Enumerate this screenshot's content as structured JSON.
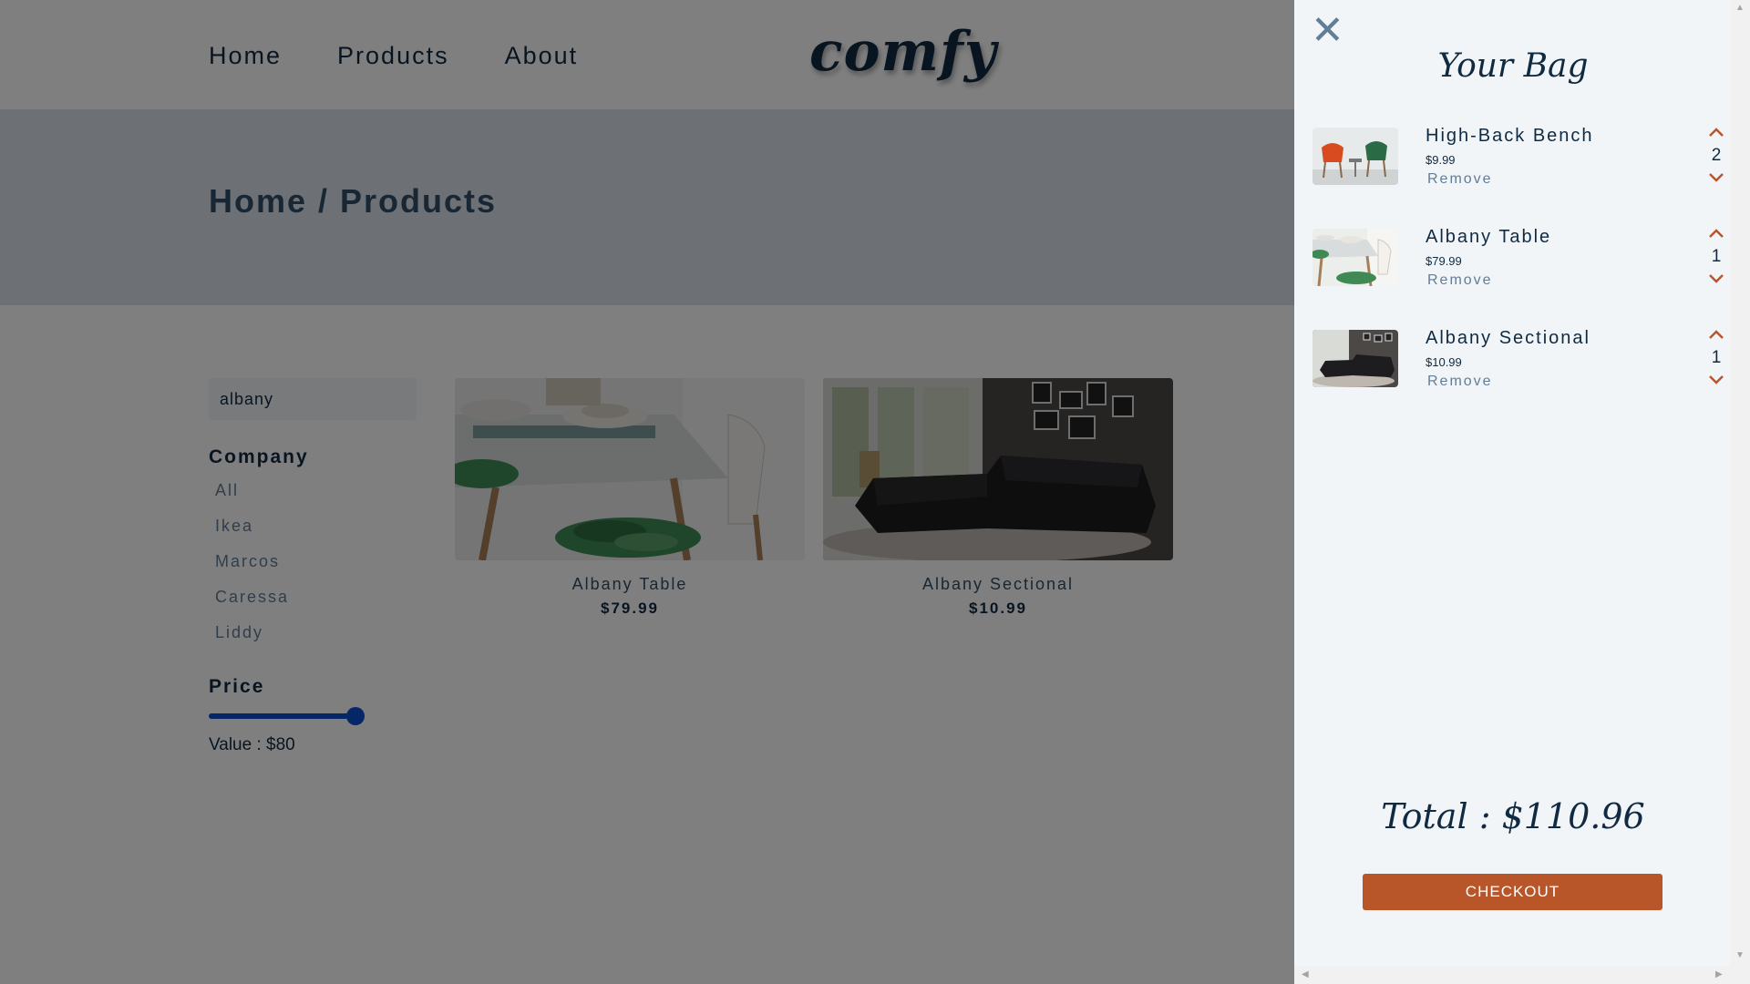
{
  "nav": {
    "links": [
      "Home",
      "Products",
      "About"
    ],
    "logo": "comfy"
  },
  "hero": {
    "breadcrumb": "Home / Products"
  },
  "filters": {
    "search_value": "albany",
    "company_title": "Company",
    "companies": [
      "All",
      "Ikea",
      "Marcos",
      "Caressa",
      "Liddy"
    ],
    "price_title": "Price",
    "price_value_text": "Value : $80",
    "price_slider_fraction": 1.0
  },
  "products": [
    {
      "name": "Albany Table",
      "price": "$79.99",
      "image": "table-photo"
    },
    {
      "name": "Albany Sectional",
      "price": "$10.99",
      "image": "sectional-photo"
    }
  ],
  "cart": {
    "title": "Your Bag",
    "close_icon": "close-icon",
    "items": [
      {
        "name": "High-Back Bench",
        "price": "$9.99",
        "remove": "Remove",
        "amount": "2",
        "image": "bench-photo"
      },
      {
        "name": "Albany Table",
        "price": "$79.99",
        "remove": "Remove",
        "amount": "1",
        "image": "table-photo"
      },
      {
        "name": "Albany Sectional",
        "price": "$10.99",
        "remove": "Remove",
        "amount": "1",
        "image": "sectional-photo"
      }
    ],
    "total": "Total : $110.96",
    "checkout": "CHECKOUT"
  },
  "colors": {
    "primary_dark": "#102a42",
    "accent": "#b8562a",
    "slider": "#0d4fcf",
    "cart_bg": "#f1f5f8",
    "hero_bg": "#dae2ec"
  }
}
